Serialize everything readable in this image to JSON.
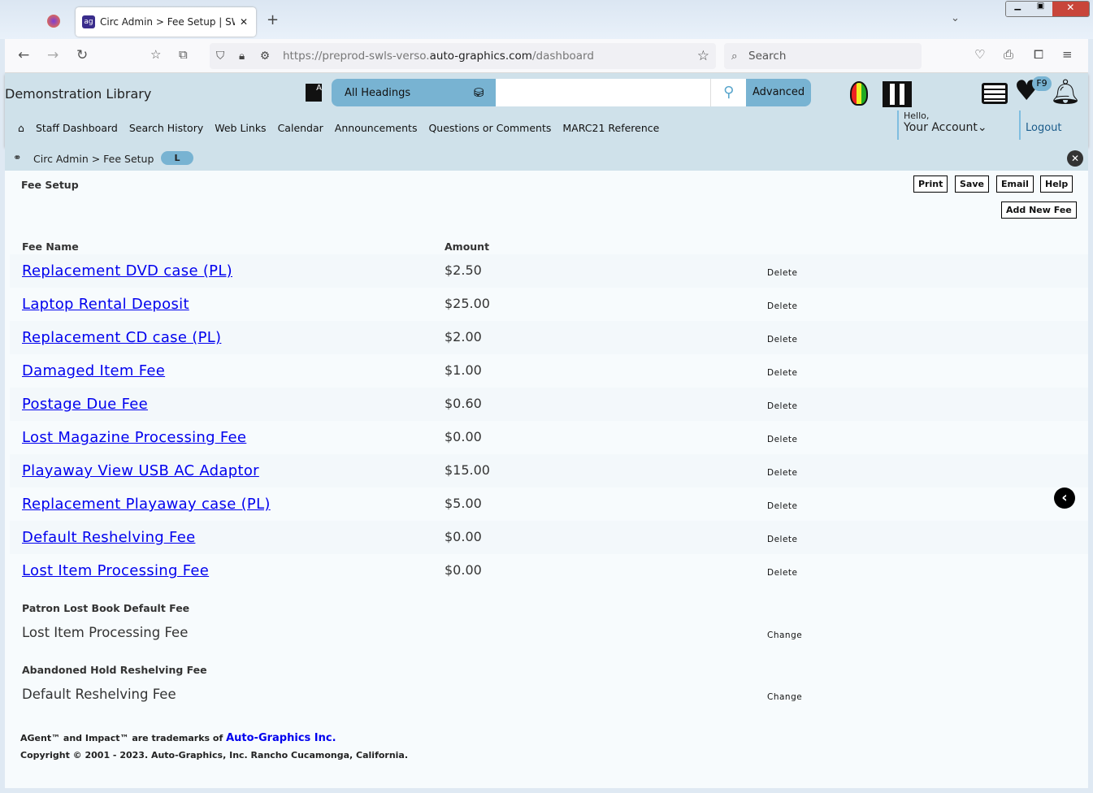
{
  "browser": {
    "tab_title": "Circ Admin > Fee Setup | SWLS",
    "url_prefix": "https://preprod-swls-verso.",
    "url_domain": "auto-graphics.com",
    "url_suffix": "/dashboard",
    "search_placeholder": "Search"
  },
  "header": {
    "library": "Demonstration Library",
    "heading_select": "All Headings",
    "advanced": "Advanced",
    "badge": "F9",
    "hello": "Hello,",
    "account": "Your Account",
    "logout": "Logout",
    "menu": [
      "Staff Dashboard",
      "Search History",
      "Web Links",
      "Calendar",
      "Announcements",
      "Questions or Comments",
      "MARC21 Reference"
    ]
  },
  "breadcrumb": {
    "text": "Circ Admin > Fee Setup",
    "pill": "L"
  },
  "page": {
    "title": "Fee Setup",
    "buttons": {
      "print": "Print",
      "save": "Save",
      "email": "Email",
      "help": "Help",
      "add": "Add New Fee"
    },
    "col_name": "Fee Name",
    "col_amount": "Amount",
    "delete": "Delete",
    "change": "Change",
    "fees": [
      {
        "name": "Replacement DVD case (PL)",
        "amount": "$2.50"
      },
      {
        "name": "Laptop Rental Deposit",
        "amount": "$25.00"
      },
      {
        "name": "Replacement CD case (PL)",
        "amount": "$2.00"
      },
      {
        "name": "Damaged Item Fee",
        "amount": "$1.00"
      },
      {
        "name": "Postage Due Fee",
        "amount": "$0.60"
      },
      {
        "name": "Lost Magazine Processing Fee",
        "amount": "$0.00"
      },
      {
        "name": "Playaway View USB AC Adaptor",
        "amount": "$15.00"
      },
      {
        "name": "Replacement Playaway case (PL)",
        "amount": "$5.00"
      },
      {
        "name": "Default Reshelving Fee",
        "amount": "$0.00"
      },
      {
        "name": "Lost Item Processing Fee",
        "amount": "$0.00"
      }
    ],
    "lost_label": "Patron Lost Book Default Fee",
    "lost_value": "Lost Item Processing Fee",
    "hold_label": "Abandoned Hold Reshelving Fee",
    "hold_value": "Default Reshelving Fee"
  },
  "footer": {
    "tm": "AGent™ and Impact™ are trademarks of ",
    "link": "Auto-Graphics Inc.",
    "copyright": "Copyright © 2001 - 2023. Auto-Graphics, Inc. Rancho Cucamonga, California."
  }
}
